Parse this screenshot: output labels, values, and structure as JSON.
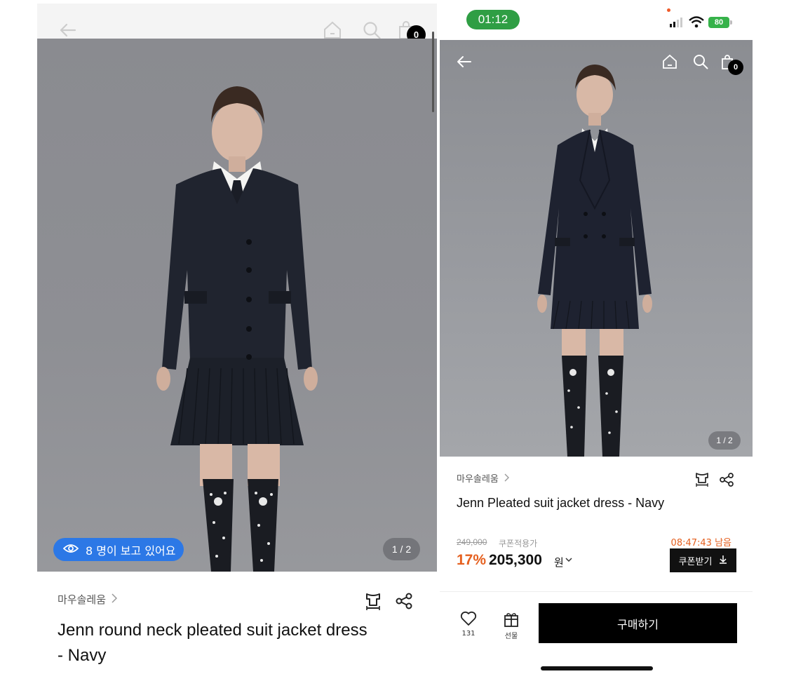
{
  "left": {
    "cart_count": "0",
    "viewers_text": "8 명이 보고 있어요",
    "pager": "1 / 2",
    "brand": "마우솔레움",
    "title_line1": "Jenn round neck pleated suit jacket dress",
    "title_line2": "- Navy"
  },
  "right": {
    "status_time": "01:12",
    "battery": "80",
    "cart_count": "0",
    "pager": "1 / 2",
    "brand": "마우솔레움",
    "title": "Jenn Pleated suit jacket dress - Navy",
    "original_price": "249,000",
    "coupon_note": "쿠폰적용가",
    "countdown": "08:47:43 남음",
    "discount": "17%",
    "price": "205,300",
    "currency": "원",
    "coupon_button": "쿠폰받기",
    "likes_count": "131",
    "gift_label": "선물",
    "buy_button": "구매하기"
  },
  "colors": {
    "accent_orange": "#e5601f",
    "viewer_badge_blue": "#2c78e6",
    "status_green": "#2f9e44"
  },
  "icons": [
    "back-arrow-icon",
    "home-icon",
    "search-icon",
    "cart-icon",
    "eye-icon",
    "size-guide-icon",
    "share-icon",
    "chevron-right-icon",
    "chevron-down-icon",
    "download-icon",
    "heart-icon",
    "gift-icon",
    "signal-icon",
    "wifi-icon",
    "battery-icon"
  ]
}
